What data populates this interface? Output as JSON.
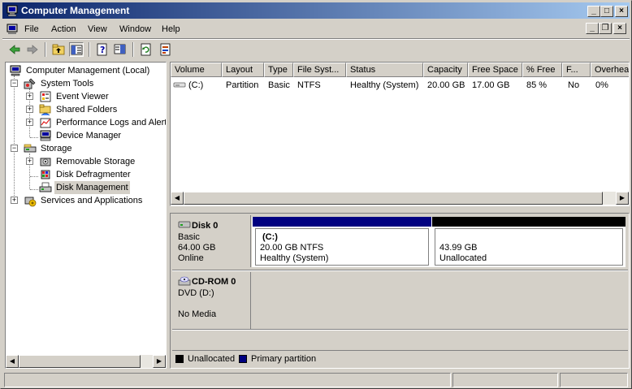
{
  "window": {
    "title": "Computer Management",
    "minimize_glyph": "_",
    "maximize_glyph": "□",
    "close_glyph": "×",
    "icon": "computer-management-icon"
  },
  "menu": {
    "items": [
      "File",
      "Action",
      "View",
      "Window",
      "Help"
    ],
    "mdi_minimize_glyph": "_",
    "mdi_restore_glyph": "❐",
    "mdi_close_glyph": "×"
  },
  "toolbar": {
    "buttons": [
      "back-arrow-icon",
      "forward-arrow-icon",
      "up-folder-icon",
      "show-hide-tree-icon",
      "properties-icon",
      "help-icon",
      "refresh-icon",
      "export-icon"
    ]
  },
  "tree": {
    "root": "Computer Management (Local)",
    "system_tools": "System Tools",
    "event_viewer": "Event Viewer",
    "shared_folders": "Shared Folders",
    "performance_logs": "Performance Logs and Alerts",
    "device_manager": "Device Manager",
    "storage": "Storage",
    "removable_storage": "Removable Storage",
    "disk_defragmenter": "Disk Defragmenter",
    "disk_management": "Disk Management",
    "services_apps": "Services and Applications",
    "expand_glyph": "+",
    "collapse_glyph": "−"
  },
  "volume_list": {
    "columns": [
      "Volume",
      "Layout",
      "Type",
      "File Syst...",
      "Status",
      "Capacity",
      "Free Space",
      "% Free",
      "F...",
      "Overhead"
    ],
    "rows": [
      {
        "volume": "(C:)",
        "layout": "Partition",
        "type": "Basic",
        "file_system": "NTFS",
        "status": "Healthy (System)",
        "capacity": "20.00 GB",
        "free_space": "17.00 GB",
        "percent_free": "85 %",
        "fault_tolerance": "No",
        "overhead": "0%"
      }
    ]
  },
  "disks": {
    "disk0": {
      "name": "Disk 0",
      "type": "Basic",
      "size": "64.00 GB",
      "state": "Online",
      "partitions": [
        {
          "label": "(C:)",
          "size_fs": "20.00 GB NTFS",
          "status": "Healthy (System)",
          "color": "#000080"
        },
        {
          "label": "",
          "size_fs": "43.99 GB",
          "status": "Unallocated",
          "color": "#000000"
        }
      ]
    },
    "cdrom0": {
      "name": "CD-ROM 0",
      "type": "DVD (D:)",
      "state": "No Media"
    }
  },
  "legend": {
    "unallocated": "Unallocated",
    "unallocated_color": "#000000",
    "primary": "Primary partition",
    "primary_color": "#000080"
  },
  "scroll_glyphs": {
    "left": "◀",
    "right": "▶"
  }
}
